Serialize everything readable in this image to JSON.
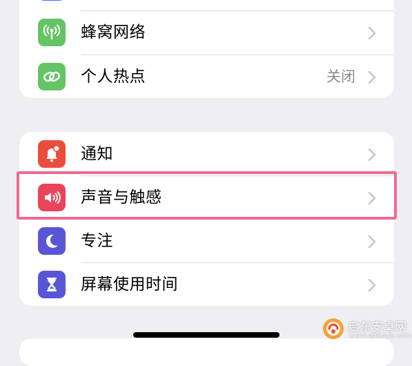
{
  "settings": {
    "cellular": {
      "label": "蜂窝网络",
      "icon": "antenna-icon",
      "color": "#65c466"
    },
    "hotspot": {
      "label": "个人热点",
      "value": "关闭",
      "icon": "link-icon",
      "color": "#65c466"
    },
    "notifications": {
      "label": "通知",
      "icon": "bell-badge-icon",
      "color": "#eb4d3d"
    },
    "sounds": {
      "label": "声音与触感",
      "icon": "speaker-icon",
      "color": "#e9455a"
    },
    "focus": {
      "label": "专注",
      "icon": "moon-icon",
      "color": "#5856d6"
    },
    "screen_time": {
      "label": "屏幕使用时间",
      "icon": "hourglass-icon",
      "color": "#5856d6"
    }
  },
  "highlight_color": "#f06b8e",
  "watermark": {
    "name": "启东安卓网",
    "url": "www.qdltdub.com"
  }
}
